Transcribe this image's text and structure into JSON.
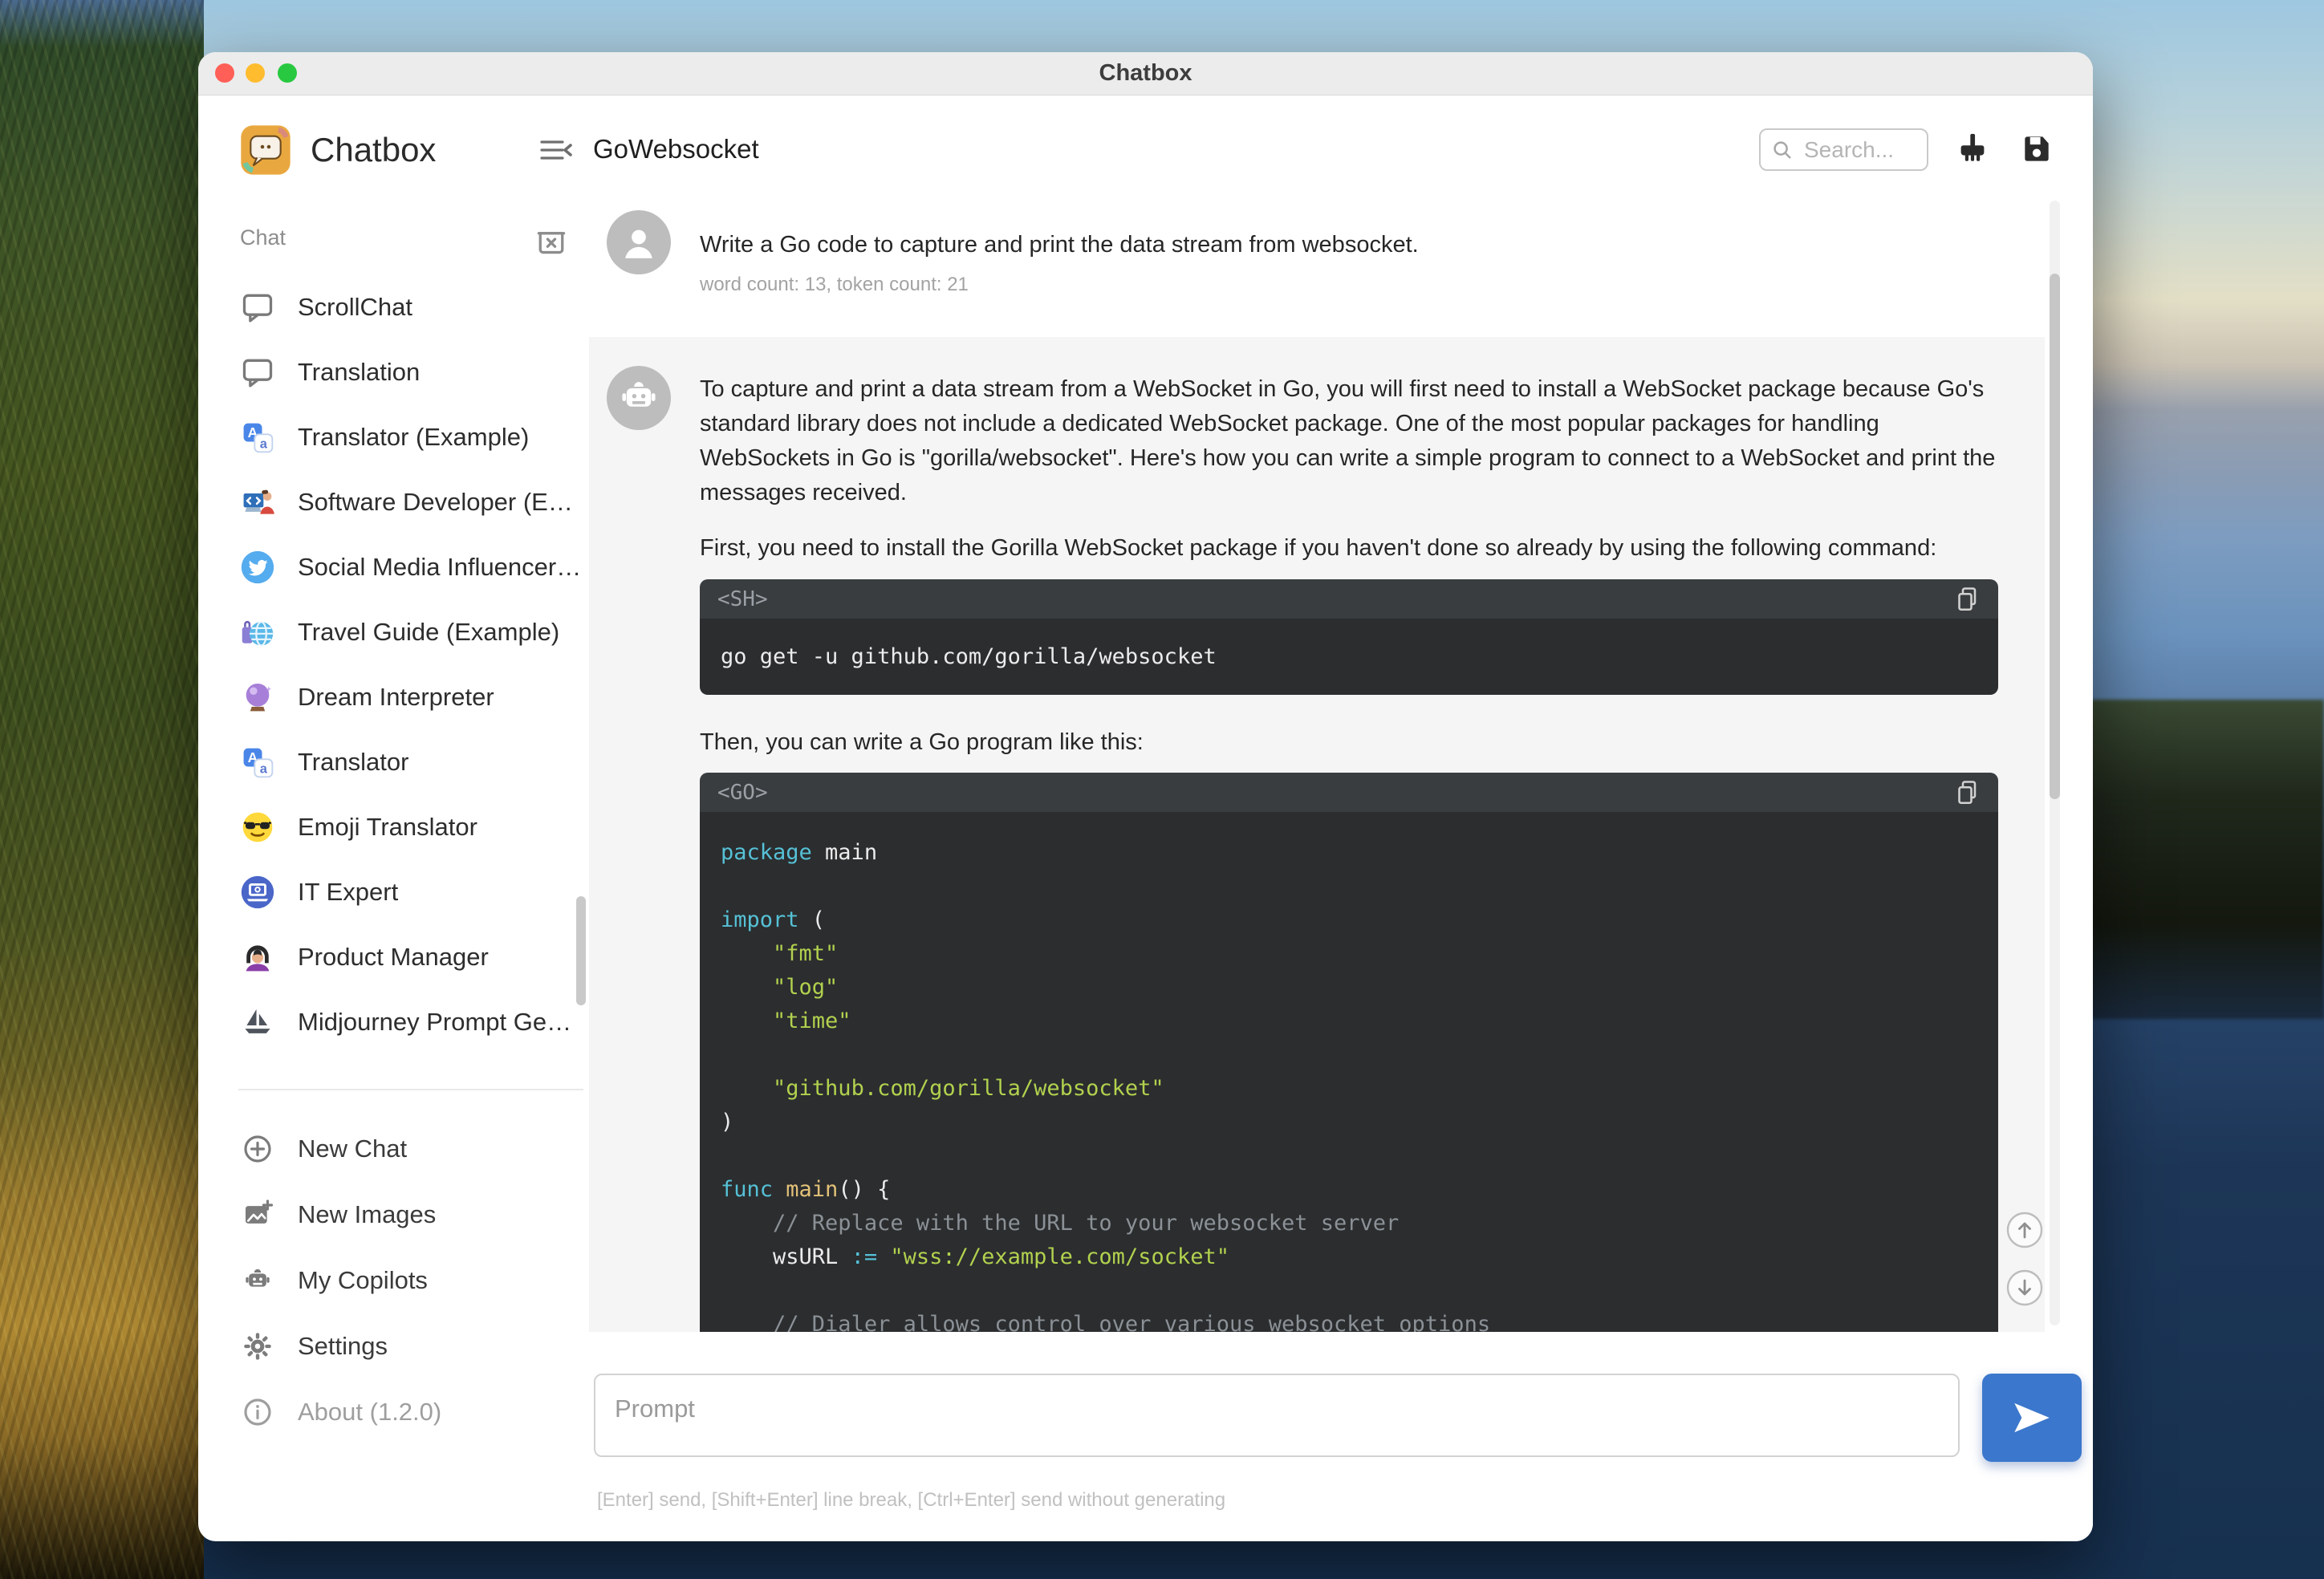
{
  "titlebar": {
    "title": "Chatbox"
  },
  "sidebar": {
    "app_name": "Chatbox",
    "section_label": "Chat",
    "chats": [
      {
        "icon": "chat-bubble",
        "label": "ScrollChat"
      },
      {
        "icon": "chat-bubble",
        "label": "Translation"
      },
      {
        "icon": "translate",
        "label": "Translator (Example)"
      },
      {
        "icon": "developer",
        "label": "Software Developer (E…"
      },
      {
        "icon": "twitter",
        "label": "Social Media Influencer…"
      },
      {
        "icon": "travel-globe",
        "label": "Travel Guide (Example)"
      },
      {
        "icon": "crystal-ball",
        "label": "Dream Interpreter"
      },
      {
        "icon": "translate",
        "label": "Translator"
      },
      {
        "icon": "emoji-sunglasses",
        "label": "Emoji Translator"
      },
      {
        "icon": "it-laptop",
        "label": "IT Expert"
      },
      {
        "icon": "product-manager",
        "label": "Product Manager"
      },
      {
        "icon": "sailboat",
        "label": "Midjourney Prompt Ge…"
      }
    ],
    "footer": [
      {
        "icon": "plus-circle",
        "label": "New Chat"
      },
      {
        "icon": "new-image",
        "label": "New Images"
      },
      {
        "icon": "robot",
        "label": "My Copilots"
      },
      {
        "icon": "gear",
        "label": "Settings"
      },
      {
        "icon": "info",
        "label": "About (1.2.0)",
        "muted": true
      }
    ]
  },
  "header": {
    "title": "GoWebsocket",
    "search_placeholder": "Search..."
  },
  "messages": {
    "user": {
      "text": "Write a Go code to capture and print the data stream from websocket.",
      "meta": "word count: 13, token count: 21"
    },
    "assistant": {
      "para1": "To capture and print a data stream from a WebSocket in Go, you will first need to install a WebSocket package because Go's standard library does not include a dedicated WebSocket package. One of the most popular packages for handling WebSockets in Go is \"gorilla/websocket\". Here's how you can write a simple program to connect to a WebSocket and print the messages received.",
      "para2": "First, you need to install the Gorilla WebSocket package if you haven't done so already by using the following command:",
      "para3": "Then, you can write a Go program like this:",
      "code_sh": {
        "label": "<SH>",
        "line": "go get -u github.com/gorilla/websocket"
      },
      "code_go": {
        "label": "<GO>",
        "lines": [
          [
            {
              "t": "package ",
              "c": "kw"
            },
            {
              "t": "main",
              "c": "pl"
            }
          ],
          [],
          [
            {
              "t": "import",
              "c": "kw"
            },
            {
              "t": " (",
              "c": "pl"
            }
          ],
          [
            {
              "t": "    ",
              "c": "pl"
            },
            {
              "t": "\"fmt\"",
              "c": "str"
            }
          ],
          [
            {
              "t": "    ",
              "c": "pl"
            },
            {
              "t": "\"log\"",
              "c": "str"
            }
          ],
          [
            {
              "t": "    ",
              "c": "pl"
            },
            {
              "t": "\"time\"",
              "c": "str"
            }
          ],
          [],
          [
            {
              "t": "    ",
              "c": "pl"
            },
            {
              "t": "\"github.com/gorilla/websocket\"",
              "c": "str"
            }
          ],
          [
            {
              "t": ")",
              "c": "pl"
            }
          ],
          [],
          [
            {
              "t": "func ",
              "c": "kw"
            },
            {
              "t": "main",
              "c": "fn"
            },
            {
              "t": "() {",
              "c": "pl"
            }
          ],
          [
            {
              "t": "    ",
              "c": "pl"
            },
            {
              "t": "// Replace with the URL to your websocket server",
              "c": "cm"
            }
          ],
          [
            {
              "t": "    wsURL ",
              "c": "pl"
            },
            {
              "t": ":= ",
              "c": "op"
            },
            {
              "t": "\"wss://example.com/socket\"",
              "c": "str"
            }
          ],
          [],
          [
            {
              "t": "    ",
              "c": "pl"
            },
            {
              "t": "// Dialer allows control over various websocket options",
              "c": "cm"
            }
          ]
        ]
      }
    }
  },
  "composer": {
    "placeholder": "Prompt",
    "hint": "[Enter] send, [Shift+Enter] line break, [Ctrl+Enter] send without generating"
  },
  "colors": {
    "accent_blue": "#3b77cc",
    "assistant_bg": "#f5f5f6",
    "code_bg": "#2b2d2f",
    "code_header_bg": "#3a3d3f",
    "keyword_cyan": "#56c1d6",
    "func_yellow": "#e3c178",
    "string_green": "#b2d14e",
    "comment_gray": "#8b9196",
    "traffic_red": "#ff5f57",
    "traffic_yellow": "#febc2e",
    "traffic_green": "#28c840"
  }
}
